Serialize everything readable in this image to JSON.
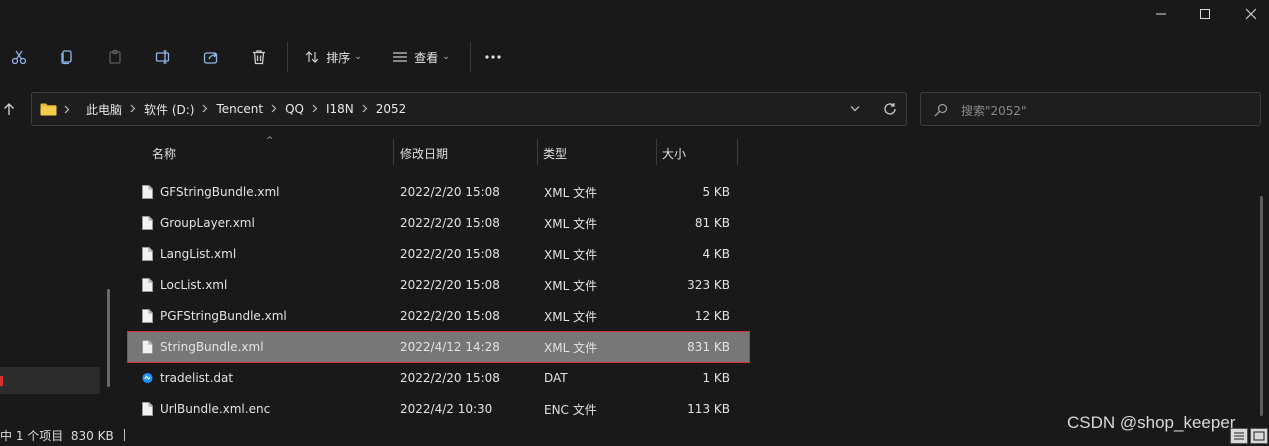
{
  "toolbar": {
    "sort_label": "排序",
    "view_label": "查看"
  },
  "address": {
    "crumbs": [
      "此电脑",
      "软件 (D:)",
      "Tencent",
      "QQ",
      "I18N",
      "2052"
    ]
  },
  "search": {
    "placeholder": "搜索\"2052\""
  },
  "columns": {
    "name": "名称",
    "modified": "修改日期",
    "type": "类型",
    "size": "大小"
  },
  "files": [
    {
      "name": "GFStringBundle.xml",
      "modified": "2022/2/20 15:08",
      "type": "XML 文件",
      "size": "5 KB",
      "icon": "document-icon"
    },
    {
      "name": "GroupLayer.xml",
      "modified": "2022/2/20 15:08",
      "type": "XML 文件",
      "size": "81 KB",
      "icon": "document-icon"
    },
    {
      "name": "LangList.xml",
      "modified": "2022/2/20 15:08",
      "type": "XML 文件",
      "size": "4 KB",
      "icon": "document-icon"
    },
    {
      "name": "LocList.xml",
      "modified": "2022/2/20 15:08",
      "type": "XML 文件",
      "size": "323 KB",
      "icon": "document-icon"
    },
    {
      "name": "PGFStringBundle.xml",
      "modified": "2022/2/20 15:08",
      "type": "XML 文件",
      "size": "12 KB",
      "icon": "document-icon"
    },
    {
      "name": "StringBundle.xml",
      "modified": "2022/4/12 14:28",
      "type": "XML 文件",
      "size": "831 KB",
      "icon": "document-icon"
    },
    {
      "name": "tradelist.dat",
      "modified": "2022/2/20 15:08",
      "type": "DAT",
      "size": "1 KB",
      "icon": "app-file-icon"
    },
    {
      "name": "UrlBundle.xml.enc",
      "modified": "2022/4/2 10:30",
      "type": "ENC 文件",
      "size": "113 KB",
      "icon": "document-icon"
    }
  ],
  "selected_index": 5,
  "status": {
    "text": "中 1 个项目  830 KB"
  },
  "watermark": "CSDN @shop_keeper",
  "colors": {
    "background": "#191919",
    "selection": "#777777",
    "highlight_border": "#d83030"
  }
}
